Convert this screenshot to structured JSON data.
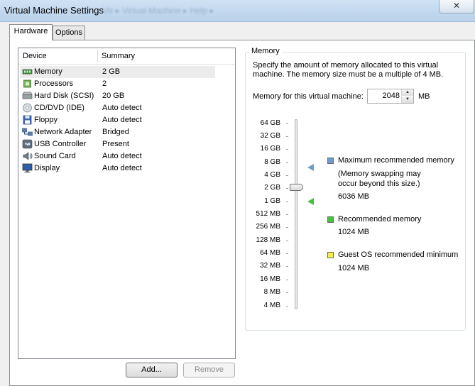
{
  "window": {
    "title": "Virtual Machine Settings",
    "title_ghost": "Vir  ▸ Virtual Machine ▸ Help ▸",
    "close_glyph": "✕"
  },
  "tabs": [
    {
      "label": "Hardware",
      "active": true
    },
    {
      "label": "Options",
      "active": false
    }
  ],
  "device_list": {
    "columns": {
      "device": "Device",
      "summary": "Summary"
    },
    "rows": [
      {
        "name": "Memory",
        "summary": "2 GB",
        "icon": "memory-icon",
        "selected": true
      },
      {
        "name": "Processors",
        "summary": "2",
        "icon": "processor-icon"
      },
      {
        "name": "Hard Disk (SCSI)",
        "summary": "20 GB",
        "icon": "hard-disk-icon"
      },
      {
        "name": "CD/DVD (IDE)",
        "summary": "Auto detect",
        "icon": "cd-dvd-icon"
      },
      {
        "name": "Floppy",
        "summary": "Auto detect",
        "icon": "floppy-icon"
      },
      {
        "name": "Network Adapter",
        "summary": "Bridged",
        "icon": "network-adapter-icon"
      },
      {
        "name": "USB Controller",
        "summary": "Present",
        "icon": "usb-icon"
      },
      {
        "name": "Sound Card",
        "summary": "Auto detect",
        "icon": "sound-card-icon"
      },
      {
        "name": "Display",
        "summary": "Auto detect",
        "icon": "display-icon"
      }
    ]
  },
  "buttons": {
    "add": "Add...",
    "remove": "Remove"
  },
  "memory": {
    "group_label": "Memory",
    "description": "Specify the amount of memory allocated to this virtual machine. The memory size must be a multiple of 4 MB.",
    "field_label": "Memory for this virtual machine:",
    "value": "2048",
    "unit": "MB",
    "scale_labels": [
      "64 GB",
      "32 GB",
      "16 GB",
      "8 GB",
      "4 GB",
      "2 GB",
      "1 GB",
      "512 MB",
      "256 MB",
      "128 MB",
      "64 MB",
      "32 MB",
      "16 MB",
      "8 MB",
      "4 MB"
    ],
    "slider_value": "2 GB",
    "legend": {
      "max_label": "Maximum recommended memory",
      "max_note": "(Memory swapping may occur beyond this size.)",
      "max_value": "6036 MB",
      "rec_label": "Recommended memory",
      "rec_value": "1024 MB",
      "min_label": "Guest OS recommended minimum",
      "min_value": "1024 MB"
    }
  },
  "colors": {
    "max_marker": "#6f9bd1",
    "rec_marker": "#46c23e",
    "min_marker": "#f2ef4c"
  }
}
